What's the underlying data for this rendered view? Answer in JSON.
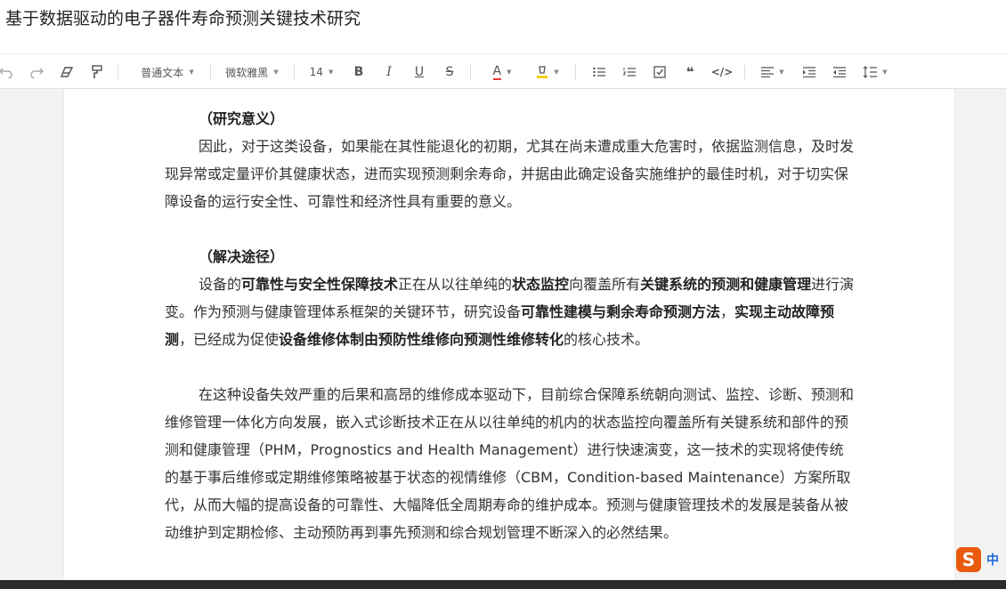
{
  "document": {
    "title": "基于数据驱动的电子器件寿命预测关键技术研究"
  },
  "toolbar": {
    "paragraph_style": "普通文本",
    "font_family": "微软雅黑",
    "font_size": "14",
    "bold": "B",
    "italic": "I",
    "underline": "U",
    "strikethrough": "S",
    "font_color": "A",
    "code": "</>",
    "quote": "❝"
  },
  "body": {
    "section1_heading": "（研究意义）",
    "p1": "因此，对于这类设备，如果能在其性能退化的初期，尤其在尚未遭成重大危害时，依据监测信息，及时发现异常或定量评价其健康状态，进而实现预测剩余寿命，并据由此确定设备实施维护的最佳时机，对于切实保障设备的运行安全性、可靠性和经济性具有重要的意义。",
    "section2_heading": "（解决途径）",
    "p2": {
      "t1": "设备的",
      "b1": "可靠性与安全性保障技术",
      "t2": "正在从以往单纯的",
      "b2": "状态监控",
      "t3": "向覆盖所有",
      "b3": "关键系统的预测和健康管理",
      "t4": "进行演变。作为预测与健康管理体系框架的关键环节，研究设备",
      "b4": "可靠性建模与剩余寿命预测方法",
      "t5": "，",
      "b5": "实现主动故障预测",
      "t6": "，已经成为促使",
      "b6": "设备维修体制由预防性维修向预测性维修转化",
      "t7": "的核心技术。"
    },
    "p3": "在这种设备失效严重的后果和高昂的维修成本驱动下，目前综合保障系统朝向测试、监控、诊断、预测和维修管理一体化方向发展，嵌入式诊断技术正在从以往单纯的机内的状态监控向覆盖所有关键系统和部件的预测和健康管理（PHM，Prognostics and Health Management）进行快速演变，这一技术的实现将使传统的基于事后维修或定期维修策略被基于状态的视情维修（CBM，Condition-based Maintenance）方案所取代，从而大幅的提高设备的可靠性、大幅降低全周期寿命的维护成本。预测与健康管理技术的发展是装备从被动维护到定期检修、主动预防再到事先预测和综合规划管理不断深入的必然结果。"
  },
  "ime": {
    "logo": "S",
    "language": "中"
  },
  "colors": {
    "accent_font_color": "#e53935",
    "highlight_color": "#f5d20c",
    "ime_brand": "#ea5a0c"
  }
}
